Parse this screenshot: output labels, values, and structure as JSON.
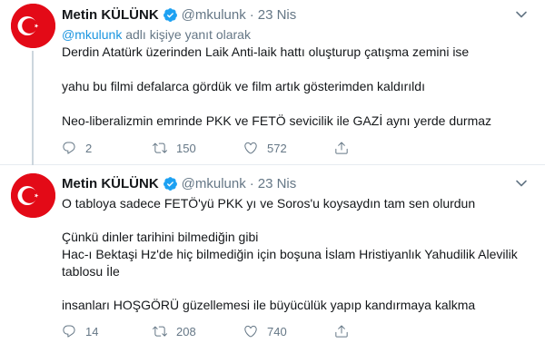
{
  "tweets": [
    {
      "author": {
        "name": "Metin KÜLÜNK",
        "handle": "@mkulunk"
      },
      "date": "23 Nis",
      "reply_to": {
        "prefix": "",
        "link": "@mkulunk",
        "suffix": " adlı kişiye yanıt olarak"
      },
      "paragraphs": [
        "Derdin Atatürk üzerinden Laik Anti-laik hattı oluşturup çatışma zemini ise",
        "yahu bu filmi defalarca gördük ve film artık gösterimden kaldırıldı",
        "Neo-liberalizmin emrinde PKK ve FETÖ sevicilik ile GAZİ aynı yerde durmaz"
      ],
      "stats": {
        "replies": "2",
        "retweets": "150",
        "likes": "572"
      }
    },
    {
      "author": {
        "name": "Metin KÜLÜNK",
        "handle": "@mkulunk"
      },
      "date": "23 Nis",
      "paragraphs": [
        "O tabloya sadece FETÖ'yü PKK yı ve Soros'u koysaydın tam sen olurdun",
        "Çünkü dinler tarihini bilmediğin gibi\nHac-ı Bektaşi Hz'de hiç bilmediğin için boşuna İslam Hristiyanlık Yahudilik Alevilik tablosu İle",
        "insanları HOŞGÖRÜ güzellemesi ile büyücülük yapıp kandırmaya kalkma"
      ],
      "stats": {
        "replies": "14",
        "retweets": "208",
        "likes": "740"
      }
    }
  ],
  "header": {
    "dot": "·"
  },
  "icons": {
    "verified": "verified-badge-icon",
    "chevron": "chevron-down-icon",
    "reply": "reply-icon",
    "retweet": "retweet-icon",
    "like": "heart-icon",
    "share": "share-icon"
  },
  "colors": {
    "accent": "#1b95e0",
    "muted": "#657786",
    "flag_red": "#e30a17"
  }
}
